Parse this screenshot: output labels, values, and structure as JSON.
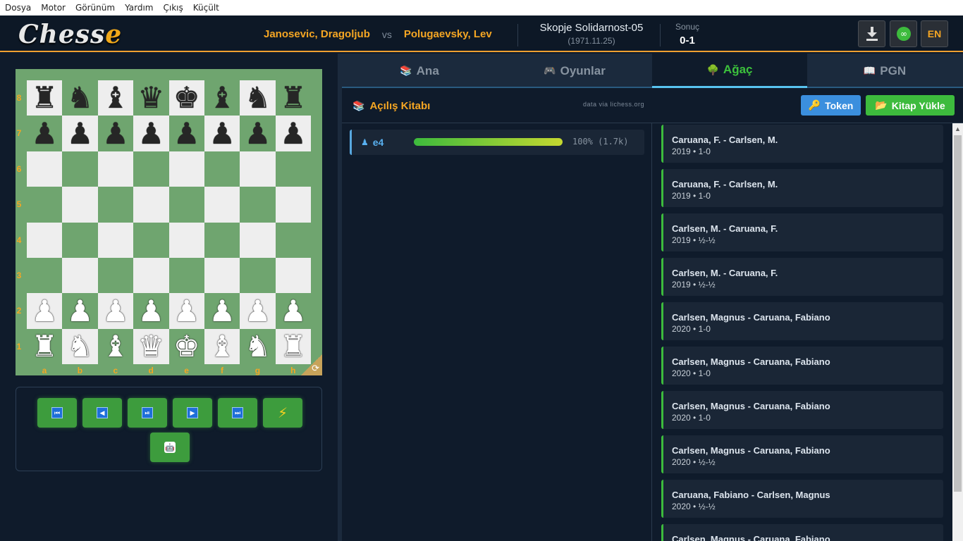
{
  "menu": [
    "Dosya",
    "Motor",
    "Görünüm",
    "Yardım",
    "Çıkış",
    "Küçült"
  ],
  "header": {
    "logo_main": "Chess",
    "logo_accent": "e",
    "white_player": "Janosevic, Dragoljub",
    "vs": "vs",
    "black_player": "Polugaevsky, Lev",
    "event": "Skopje Solidarnost-05",
    "date": "(1971.11.25)",
    "result_label": "Sonuç",
    "result_value": "0-1",
    "lang_button": "EN"
  },
  "board": {
    "ranks": [
      "8",
      "7",
      "6",
      "5",
      "4",
      "3",
      "2",
      "1"
    ],
    "files": [
      "a",
      "b",
      "c",
      "d",
      "e",
      "f",
      "g",
      "h"
    ],
    "position": [
      [
        "r",
        "n",
        "b",
        "q",
        "k",
        "b",
        "n",
        "r"
      ],
      [
        "p",
        "p",
        "p",
        "p",
        "p",
        "p",
        "p",
        "p"
      ],
      [
        "",
        "",
        "",
        "",
        "",
        "",
        "",
        ""
      ],
      [
        "",
        "",
        "",
        "",
        "",
        "",
        "",
        ""
      ],
      [
        "",
        "",
        "",
        "",
        "",
        "",
        "",
        ""
      ],
      [
        "",
        "",
        "",
        "",
        "",
        "",
        "",
        ""
      ],
      [
        "P",
        "P",
        "P",
        "P",
        "P",
        "P",
        "P",
        "P"
      ],
      [
        "R",
        "N",
        "B",
        "Q",
        "K",
        "B",
        "N",
        "R"
      ]
    ]
  },
  "controls": [
    {
      "name": "first-move-button",
      "icon": "⏮"
    },
    {
      "name": "prev-move-button",
      "icon": "◀"
    },
    {
      "name": "play-pause-button",
      "icon": "⏯"
    },
    {
      "name": "next-move-button",
      "icon": "▶"
    },
    {
      "name": "last-move-button",
      "icon": "⏭"
    },
    {
      "name": "engine-button",
      "icon": "⚡"
    },
    {
      "name": "robot-button",
      "icon": "🤖"
    }
  ],
  "tabs": [
    {
      "label": "Ana",
      "icon": "📚",
      "active": false
    },
    {
      "label": "Oyunlar",
      "icon": "🎮",
      "active": false
    },
    {
      "label": "Ağaç",
      "icon": "🌳",
      "active": true
    },
    {
      "label": "PGN",
      "icon": "📖",
      "active": false
    }
  ],
  "toolbar": {
    "title": "Açılış Kitabı",
    "source": "data via lichess.org",
    "token_label": "Token",
    "book_label": "Kitap Yükle"
  },
  "moves": [
    {
      "move": "e4",
      "percent": 100,
      "stats": "100% (1.7k)"
    }
  ],
  "games": [
    {
      "title": "Caruana, F. - Carlsen, M.",
      "sub": "2019 • 1-0"
    },
    {
      "title": "Caruana, F. - Carlsen, M.",
      "sub": "2019 • 1-0"
    },
    {
      "title": "Carlsen, M. - Caruana, F.",
      "sub": "2019 • ½-½"
    },
    {
      "title": "Carlsen, M. - Caruana, F.",
      "sub": "2019 • ½-½"
    },
    {
      "title": "Carlsen, Magnus - Caruana, Fabiano",
      "sub": "2020 • 1-0"
    },
    {
      "title": "Carlsen, Magnus - Caruana, Fabiano",
      "sub": "2020 • 1-0"
    },
    {
      "title": "Carlsen, Magnus - Caruana, Fabiano",
      "sub": "2020 • 1-0"
    },
    {
      "title": "Carlsen, Magnus - Caruana, Fabiano",
      "sub": "2020 • ½-½"
    },
    {
      "title": "Caruana, Fabiano - Carlsen, Magnus",
      "sub": "2020 • ½-½"
    },
    {
      "title": "Carlsen, Magnus - Caruana, Fabiano",
      "sub": ""
    }
  ],
  "colors": {
    "accent": "#f5a623",
    "green": "#3dbb3d",
    "blue": "#3b8fde",
    "board_dark": "#6fa56f",
    "board_light": "#eeeeee"
  }
}
